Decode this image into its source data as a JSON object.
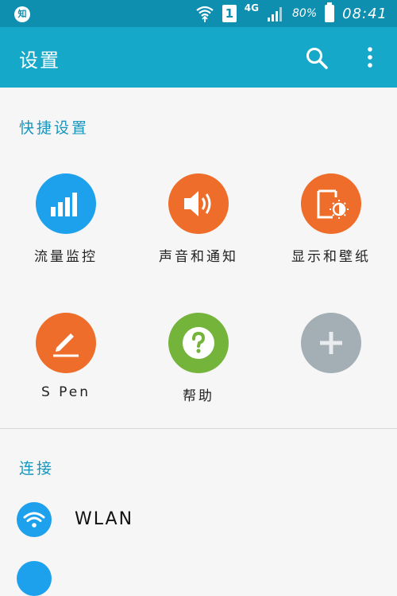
{
  "status_bar": {
    "app_badge": "知",
    "sim_slot": "1",
    "network_type": "4G",
    "battery": "80%",
    "time": "08:41",
    "icons": [
      "wifi-icon",
      "signal-icon",
      "battery-icon"
    ]
  },
  "app_bar": {
    "title": "设置",
    "icons": [
      "search-icon",
      "more-vert-icon"
    ]
  },
  "quick_settings": {
    "header": "快捷设置",
    "items": [
      {
        "label": "流量监控",
        "icon": "bar-chart-icon",
        "color": "#1ea1ed"
      },
      {
        "label": "声音和通知",
        "icon": "speaker-icon",
        "color": "#ee6d2a"
      },
      {
        "label": "显示和壁纸",
        "icon": "display-brightness-icon",
        "color": "#ee6d2a"
      },
      {
        "label": "S Pen",
        "icon": "pen-icon",
        "color": "#ee6d2a"
      },
      {
        "label": "帮助",
        "icon": "help-icon",
        "color": "#75b43b"
      },
      {
        "label": "",
        "icon": "add-icon",
        "color": "#a3aeb5"
      }
    ]
  },
  "connections": {
    "header": "连接",
    "items": [
      {
        "label": "WLAN",
        "icon": "wifi-icon",
        "color": "#1ea1ed"
      }
    ]
  }
}
